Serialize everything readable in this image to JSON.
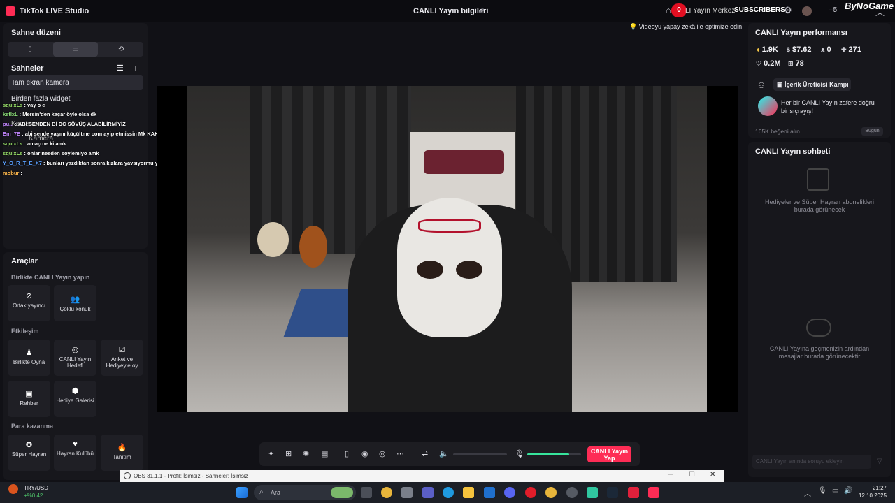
{
  "titlebar": {
    "app_name": "TikTok LIVE Studio",
    "center_title": "CANLI Yayın bilgileri",
    "share_icon": "share-icon",
    "overlay_count": "0",
    "overlay_text": "LI Yayın Merkez",
    "subscribers": "SUBSCRIBERS",
    "right_count": "5",
    "brand": "ByNoGame"
  },
  "sidebar": {
    "layout_title": "Sahne düzeni",
    "layout_options": [
      "portrait",
      "landscape",
      "rotate"
    ],
    "scenes_title": "Sahneler",
    "scenes": [
      "Tam ekran kamera",
      "Birden fazla widget"
    ],
    "hidden_items": [
      "Kamera",
      "Kamera"
    ],
    "chat_overlay": [
      {
        "user": "squixLs",
        "user_color": "#9be36b",
        "text": "vay o e"
      },
      {
        "user": "ketIxL",
        "user_color": "#8fe37b",
        "text": "Mersin'den kaçar öyle olsa dk"
      },
      {
        "user": "pu...",
        "user_color": "#c387ff",
        "text": "ABİ SENDEN Bİ DC SÖVÜŞ ALABİLİRMİYİZ"
      },
      {
        "user": "Em_7E",
        "user_color": "#c387ff",
        "text": "abi sende yaşını küçültme com ayip etmissin Mk KAKFNANGMAKFKSJD salaklar mk"
      },
      {
        "user": "squixLs",
        "user_color": "#9be36b",
        "text": "amaç ne ki amk"
      },
      {
        "user": "squixLs",
        "user_color": "#9be36b",
        "text": "onlar needen söylemiyo amk"
      },
      {
        "user": "Y_O_R_T_E_X7",
        "user_color": "#5aa0ff",
        "text": "bunları yazdıktan sonra kızlara yavsıyormu yapıyormu mericlik"
      },
      {
        "user": "mobur",
        "user_color": "#ffb84d",
        "text": ""
      }
    ]
  },
  "tools": {
    "title": "Araçlar",
    "groups": [
      {
        "title": "Birlikte CANLI Yayın yapın",
        "items": [
          {
            "label": "Ortak yayıncı",
            "icon": "link-icon"
          },
          {
            "label": "Çoklu konuk",
            "icon": "people-icon"
          }
        ]
      },
      {
        "title": "Etkileşim",
        "items": [
          {
            "label": "Birlikte Oyna",
            "icon": "joystick-icon"
          },
          {
            "label": "CANLI Yayın Hedefi",
            "icon": "target-icon"
          },
          {
            "label": "Anket ve Hediyeyle oy",
            "icon": "poll-icon"
          },
          {
            "label": "Rehber",
            "icon": "guide-icon"
          },
          {
            "label": "Hediye Galerisi",
            "icon": "gift-gallery-icon"
          }
        ]
      },
      {
        "title": "Para kazanma",
        "items": [
          {
            "label": "Süper Hayran",
            "icon": "super-fan-icon"
          },
          {
            "label": "Hayran Kulübü",
            "icon": "heart-icon"
          },
          {
            "label": "Tanıtım",
            "icon": "flame-icon"
          }
        ]
      }
    ]
  },
  "stage": {
    "optimize_hint": "Videoyu yapay zekâ ile optimize edin"
  },
  "controls": {
    "volume_fraction": 0.0,
    "mic_fraction": 0.78,
    "go_live_label_1": "CANLI Yayın",
    "go_live_label_2": "Yap",
    "accent": "#fe2c55",
    "mic_color": "#37e49c"
  },
  "performance": {
    "title": "CANLI Yayın performansı",
    "stats": [
      {
        "icon": "diamond-icon",
        "value": "1.9K"
      },
      {
        "icon": "coin-icon",
        "value": "$7.62"
      },
      {
        "icon": "viewers-icon",
        "value": "0"
      },
      {
        "icon": "followers-icon",
        "value": "271"
      },
      {
        "icon": "like-icon",
        "value": "0.2M"
      },
      {
        "icon": "gift-icon",
        "value": "78"
      }
    ],
    "campaign_tab": "İçerik Üreticisi Kampı",
    "campaign_text_1": "Her bir CANLI Yayın zafere doğru",
    "campaign_text_2": "bir sıçrayış!",
    "likes_goal": "165K beğeni alın",
    "today": "Bugün"
  },
  "chat": {
    "title": "CANLI Yayın sohbeti",
    "gifts_empty_1": "Hediyeler ve Süper Hayran abonelikleri",
    "gifts_empty_2": "burada görünecek",
    "messages_empty_1": "CANLI Yayına geçmenizin ardından",
    "messages_empty_2": "mesajlar burada görünecektir",
    "input_placeholder": "CANLI Yayın anında soruyu ekleyin"
  },
  "obs": {
    "title": "OBS 31.1.1 - Profil: İsimsiz - Sahneler: İsimsiz"
  },
  "taskbar": {
    "currency": "TRY/USD",
    "currency_change": "+%0,42",
    "search_placeholder": "Ara",
    "time": "21:27",
    "date": "12.10.2025"
  }
}
